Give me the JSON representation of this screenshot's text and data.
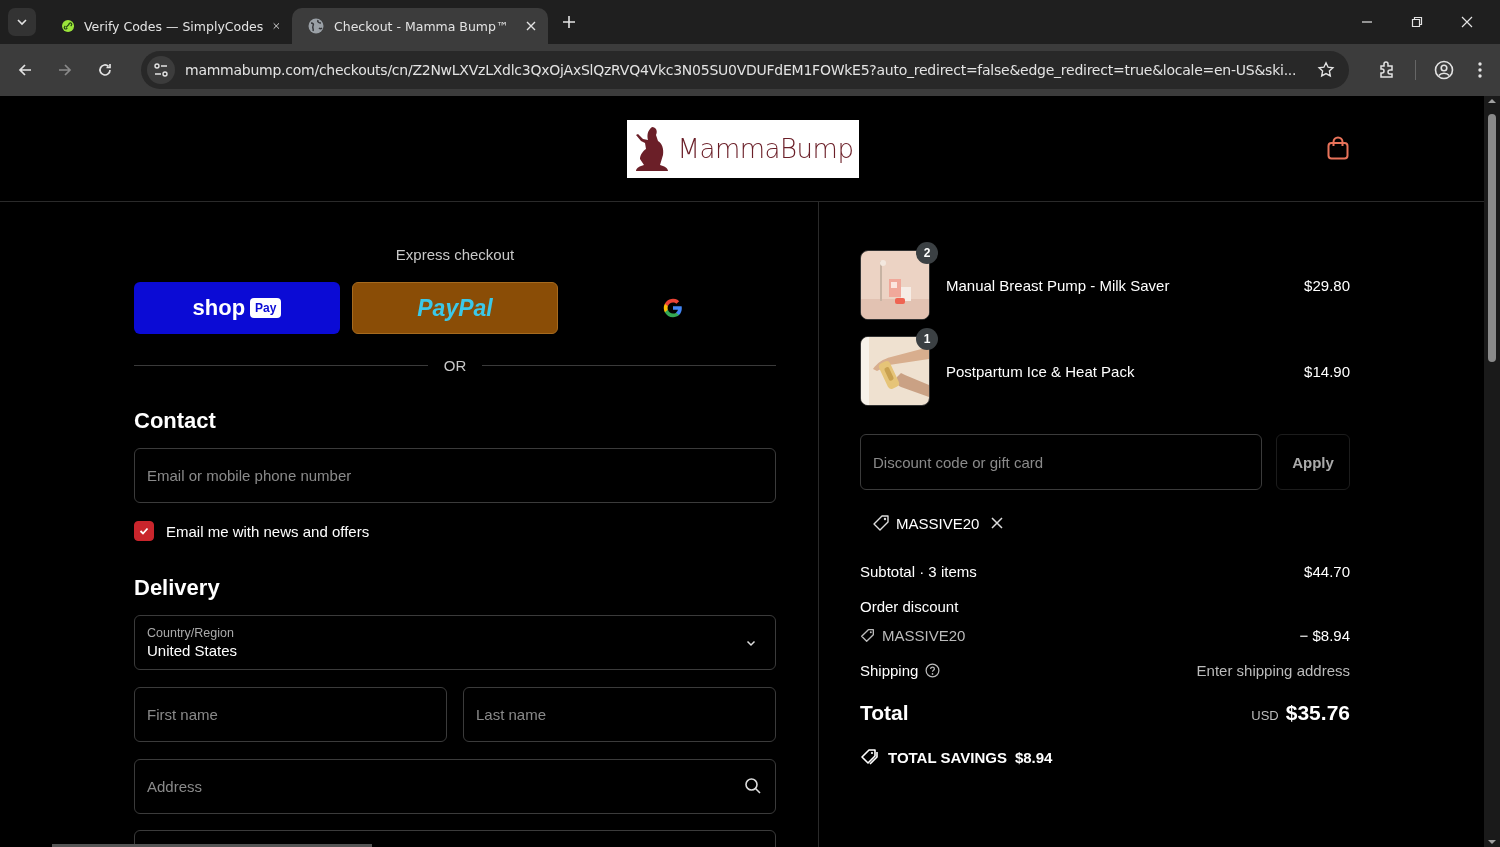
{
  "browser": {
    "tabs": [
      {
        "title": "Verify Codes — SimplyCodes",
        "selected": false,
        "kind": "simplycodes"
      },
      {
        "title": "Checkout - Mamma Bump™",
        "selected": true,
        "kind": "globe"
      }
    ],
    "url": "mammabump.com/checkouts/cn/Z2NwLXVzLXdlc3QxOjAxSlQzRVQ4Vkc3N05SU0VDUFdEM1FOWkE5?auto_redirect=false&edge_redirect=true&locale=en-US&ski..."
  },
  "header": {
    "logo": "MammaBump"
  },
  "express": {
    "title": "Express checkout",
    "buttons": [
      {
        "kind": "shop",
        "label": "shop",
        "badge": "Pay"
      },
      {
        "kind": "paypal",
        "label": "PayPal"
      },
      {
        "kind": "google"
      }
    ],
    "divider": "OR"
  },
  "contact": {
    "heading": "Contact",
    "email_placeholder": "Email or mobile phone number",
    "newsletter": {
      "label": "Email me with news and offers",
      "checked": true
    }
  },
  "delivery": {
    "heading": "Delivery",
    "country": {
      "label": "Country/Region",
      "value": "United States"
    },
    "first_name_placeholder": "First name",
    "last_name_placeholder": "Last name",
    "address_placeholder": "Address"
  },
  "cart": {
    "items": [
      {
        "name": "Manual Breast Pump - Milk Saver",
        "price": "$29.80",
        "quantity": "2",
        "kind": "pump"
      },
      {
        "name": "Postpartum Ice & Heat Pack",
        "price": "$14.90",
        "quantity": "1",
        "kind": "hands"
      }
    ],
    "discount": {
      "placeholder": "Discount code or gift card",
      "button": "Apply"
    },
    "applied_codes": [
      {
        "code": "MASSIVE20"
      }
    ],
    "summary": {
      "subtotal_label": "Subtotal · 3 items",
      "subtotal": "$44.70",
      "discount_label": "Order discount",
      "discount_code": "MASSIVE20",
      "discount_amount": "− $8.94",
      "shipping_label": "Shipping",
      "shipping_value": "Enter shipping address",
      "total_label": "Total",
      "currency": "USD",
      "total": "$35.76",
      "savings_label": "TOTAL SAVINGS",
      "savings": "$8.94"
    }
  }
}
